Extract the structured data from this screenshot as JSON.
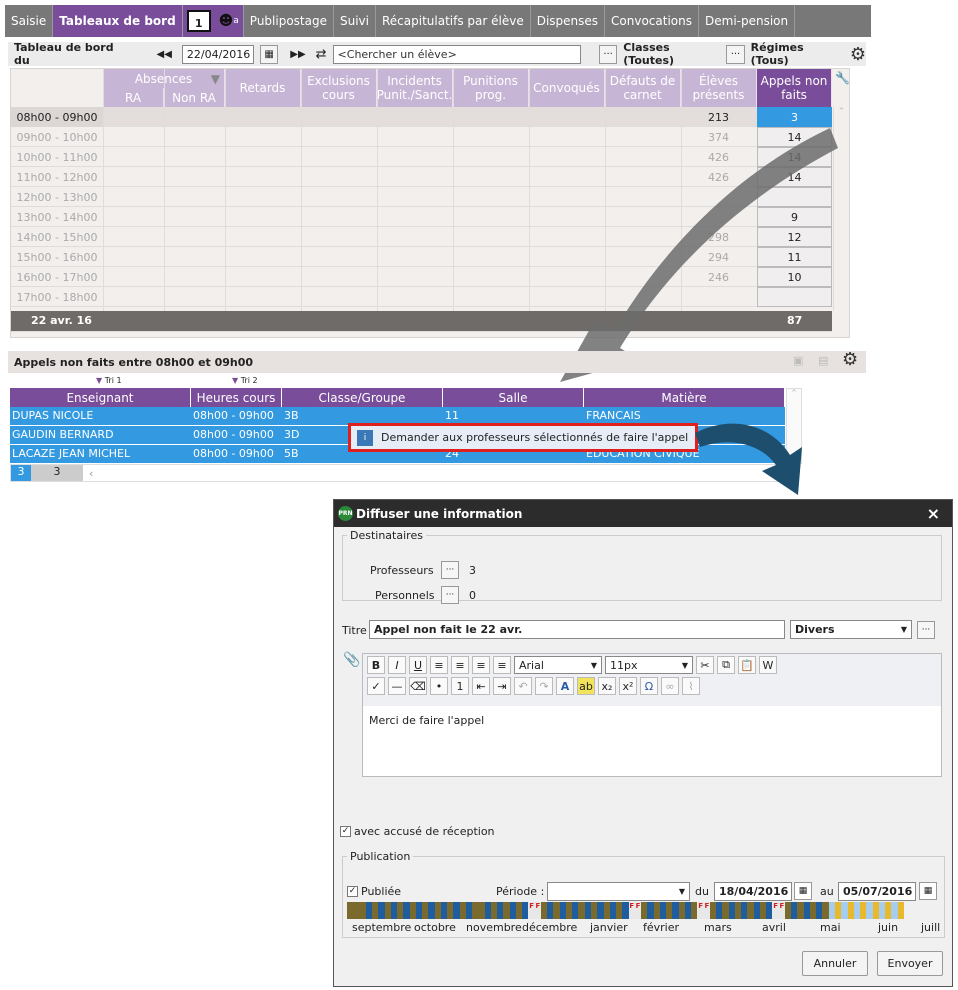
{
  "nav": {
    "tabs": [
      "Saisie",
      "Tableaux de bord",
      "Publipostage",
      "Suivi",
      "Récapitulatifs par élève",
      "Dispenses",
      "Convocations",
      "Demi-pension"
    ],
    "cal_icon": "1",
    "person_sup": "a"
  },
  "toolbar": {
    "label": "Tableau de bord du",
    "date": "22/04/2016",
    "search_placeholder": "<Chercher un élève>",
    "classes": "Classes (Toutes)",
    "regimes": "Régimes (Tous)"
  },
  "grid": {
    "group_header": "Absences",
    "sub_ra": "RA",
    "sub_nonra": "Non RA",
    "columns": [
      "Retards",
      "Exclusions cours",
      "Incidents Punit./Sanct.",
      "Punitions prog.",
      "Convoqués",
      "Défauts de carnet",
      "Élèves présents",
      "Appels non faits"
    ],
    "rows": [
      {
        "time": "08h00 - 09h00",
        "presents": "213",
        "appels": "3"
      },
      {
        "time": "09h00 - 10h00",
        "presents": "374",
        "appels": "14"
      },
      {
        "time": "10h00 - 11h00",
        "presents": "426",
        "appels": "14"
      },
      {
        "time": "11h00 - 12h00",
        "presents": "426",
        "appels": "14"
      },
      {
        "time": "12h00 - 13h00",
        "presents": "",
        "appels": ""
      },
      {
        "time": "13h00 - 14h00",
        "presents": "",
        "appels": "9"
      },
      {
        "time": "14h00 - 15h00",
        "presents": "298",
        "appels": "12"
      },
      {
        "time": "15h00 - 16h00",
        "presents": "294",
        "appels": "11"
      },
      {
        "time": "16h00 - 17h00",
        "presents": "246",
        "appels": "10"
      },
      {
        "time": "17h00 - 18h00",
        "presents": "",
        "appels": ""
      }
    ],
    "total_label": "22 avr. 16",
    "total_appels": "87"
  },
  "section": {
    "title": "Appels non faits entre 08h00 et 09h00"
  },
  "list": {
    "sort1": "Tri 1",
    "sort2": "Tri 2",
    "headers": [
      "Enseignant",
      "Heures cours",
      "Classe/Groupe",
      "Salle",
      "Matière"
    ],
    "rows": [
      {
        "teacher": "DUPAS NICOLE",
        "hours": "08h00 - 09h00",
        "class": "3B",
        "room": "11",
        "subject": "FRANCAIS"
      },
      {
        "teacher": "GAUDIN BERNARD",
        "hours": "08h00 - 09h00",
        "class": "3D",
        "room": "",
        "subject": ""
      },
      {
        "teacher": "LACAZE JEAN MICHEL",
        "hours": "08h00 - 09h00",
        "class": "5B",
        "room": "24",
        "subject": "EDUCATION CIVIQUE"
      }
    ],
    "footer_count1": "3",
    "footer_count2": "3"
  },
  "context_menu": {
    "item": "Demander aux professeurs sélectionnés de faire l'appel"
  },
  "dialog": {
    "app_badge": "PRN",
    "title": "Diffuser une information",
    "close": "×",
    "recipients_legend": "Destinataires",
    "prof_label": "Professeurs",
    "prof_count": "3",
    "staff_label": "Personnels",
    "staff_count": "0",
    "title_label": "Titre",
    "title_value": "Appel non fait le 22 avr.",
    "category": "Divers",
    "font": "Arial",
    "size": "11px",
    "body": "Merci de faire l'appel",
    "ack": "avec accusé de réception",
    "pub_legend": "Publication",
    "published": "Publiée",
    "period_label": "Période :",
    "from_label": "du",
    "from": "18/04/2016",
    "to_label": "au",
    "to": "05/07/2016",
    "holiday_mark": "F",
    "months": [
      "septembre",
      "octobre",
      "novembre",
      "décembre",
      "janvier",
      "février",
      "mars",
      "avril",
      "mai",
      "juin",
      "juill"
    ],
    "cancel": "Annuler",
    "send": "Envoyer"
  },
  "colors": {
    "accent": "#7a4d9a",
    "selection": "#3399e0",
    "highlight": "#e0201e"
  }
}
